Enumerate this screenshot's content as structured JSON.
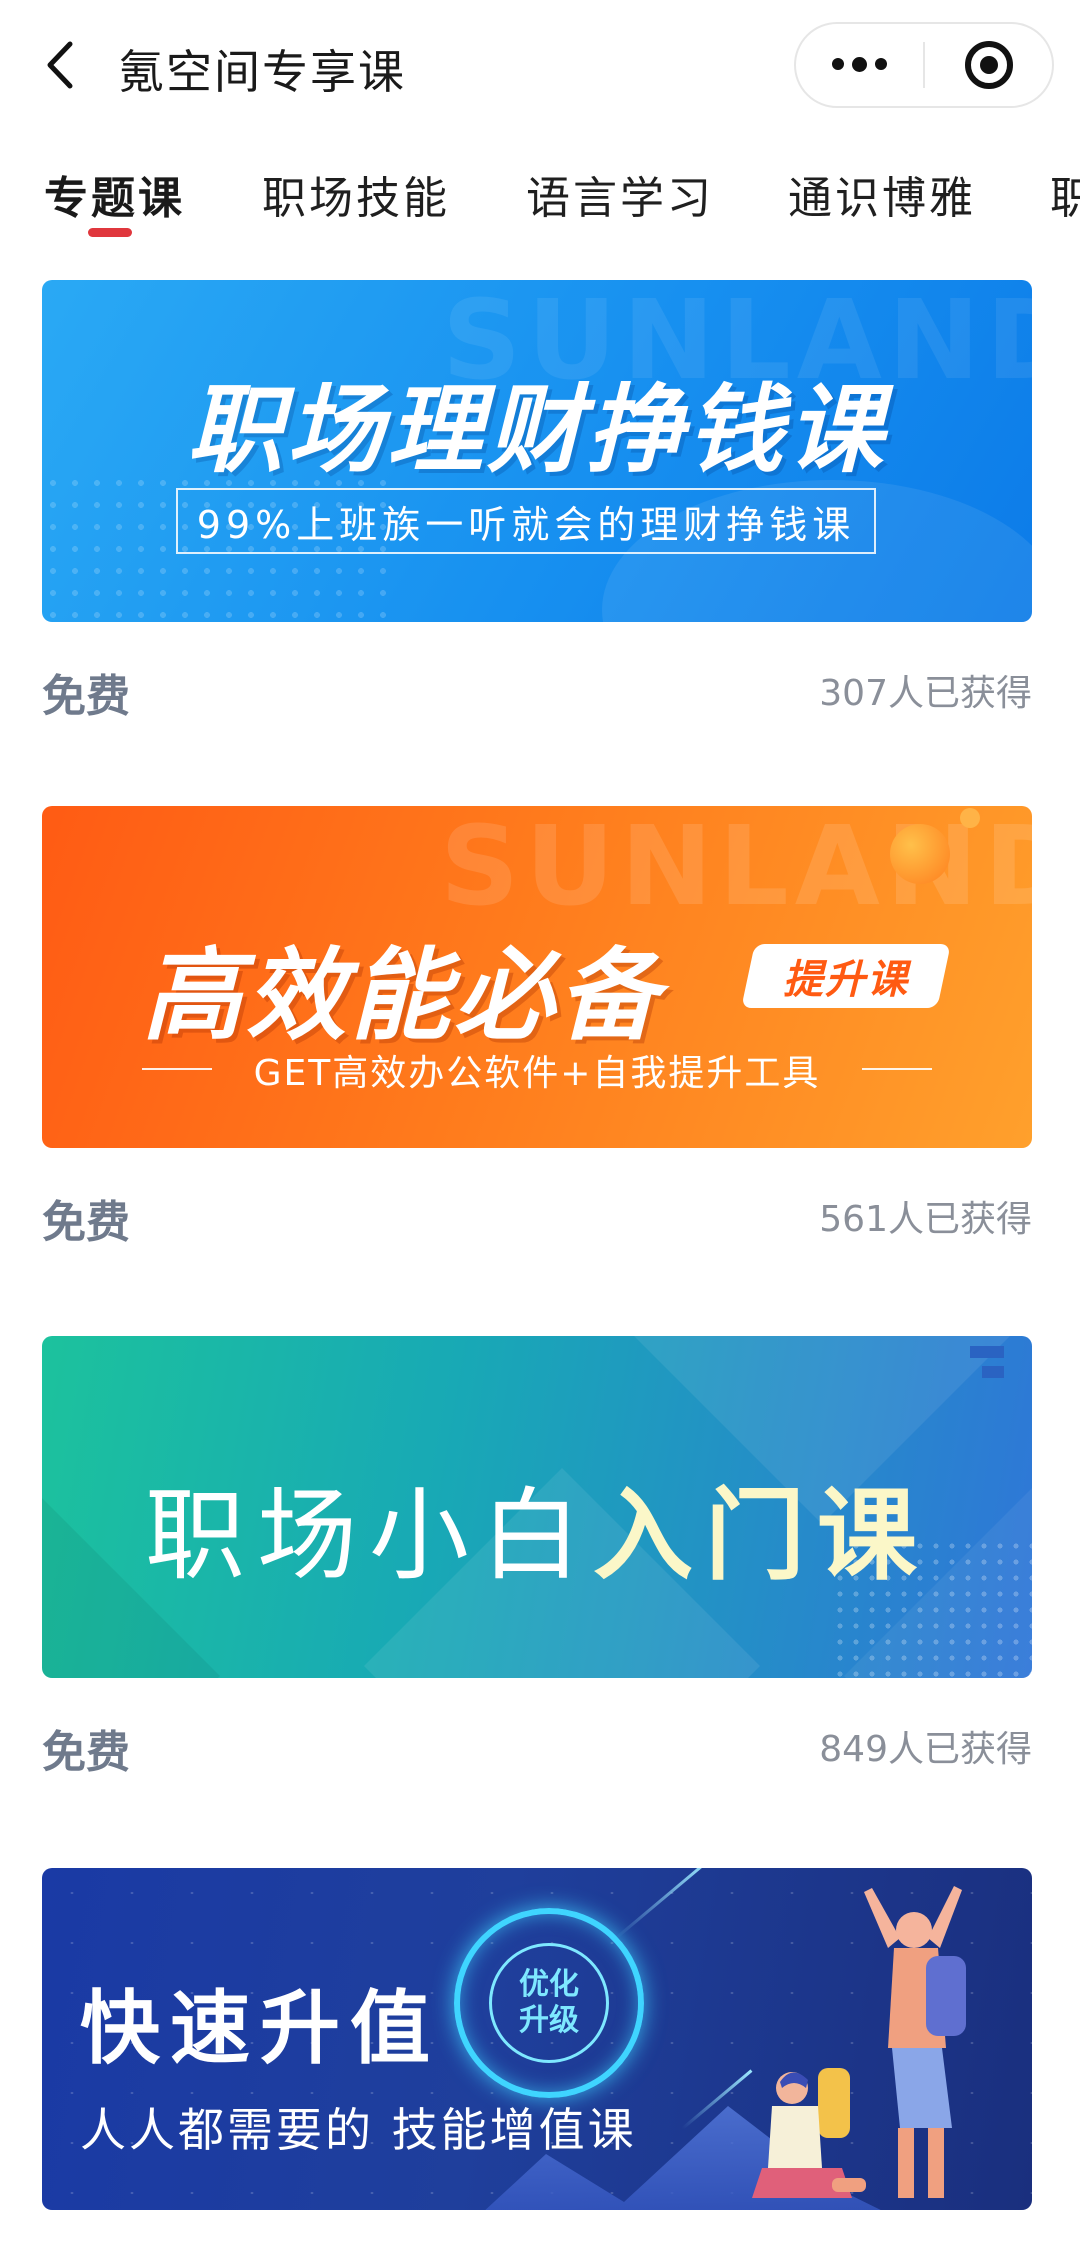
{
  "header": {
    "title": "氪空间专享课",
    "back_icon": "chevron-left-icon",
    "more_icon": "more-dots-icon",
    "close_icon": "target-circle-icon"
  },
  "tabs": [
    {
      "label": "专题课",
      "active": true
    },
    {
      "label": "职场技能",
      "active": false
    },
    {
      "label": "语言学习",
      "active": false
    },
    {
      "label": "通识博雅",
      "active": false
    },
    {
      "label": "职",
      "active": false
    }
  ],
  "accent_color": "#e0373d",
  "courses": [
    {
      "banner_watermark": "SUNLANDS",
      "banner_title": "职场理财挣钱课",
      "banner_subtitle": "99%上班族一听就会的理财挣钱课",
      "price": "免费",
      "count": "307人已获得"
    },
    {
      "banner_watermark": "SUNLANDS",
      "banner_title": "高效能必备",
      "banner_tag": "提升课",
      "banner_subtitle": "GET高效办公软件+自我提升工具",
      "price": "免费",
      "count": "561人已获得"
    },
    {
      "banner_title_light": "职场小白",
      "banner_title_bold": "入门课",
      "price": "免费",
      "count": "849人已获得"
    },
    {
      "banner_title": "快速升值",
      "banner_badge": "优化升级",
      "banner_subtitle": "人人都需要的 技能增值课"
    }
  ]
}
